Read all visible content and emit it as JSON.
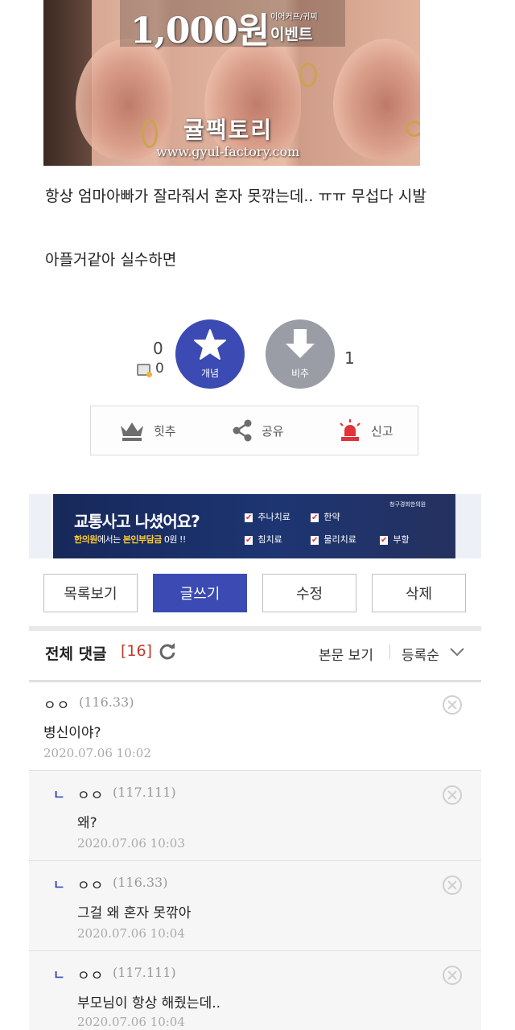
{
  "photo": {
    "price": "1,000원",
    "price_sub": "이어커프/귀찌",
    "price_event": "이벤트",
    "brand": "귤팩토리",
    "url": "www.gyul-factory.com"
  },
  "post": {
    "line1": "항상 엄마아빠가 잘라줘서 혼자 못깎는데.. ㅠㅠ 무섭다 시발",
    "line2": "아플거같아 실수하면"
  },
  "vote": {
    "up_count": "0",
    "up_fix_count": "0",
    "up_label": "개념",
    "down_label": "비추",
    "down_count": "1"
  },
  "actions": {
    "hit": "힛추",
    "share": "공유",
    "report": "신고"
  },
  "banner": {
    "title": "교통사고 나셨어요?",
    "sub_a": "한의원",
    "sub_b": "에서는 ",
    "sub_c": "본인부담금",
    "sub_d": " 0원 !!",
    "checks": [
      "추나치료",
      "한약",
      "침치료",
      "물리치료",
      "부항"
    ],
    "clinic": "청구경희한의원"
  },
  "buttons": {
    "list": "목록보기",
    "write": "글쓰기",
    "edit": "수정",
    "delete": "삭제"
  },
  "comments_header": {
    "title": "전체 댓글",
    "count": "[16]",
    "view_body": "본문 보기",
    "order": "등록순"
  },
  "comments": [
    {
      "name": "ㅇㅇ",
      "ip": "(116.33)",
      "text": "병신이야?",
      "date": "2020.07.06 10:02"
    },
    {
      "name": "ㅇㅇ",
      "ip": "(117.111)",
      "text": "왜?",
      "date": "2020.07.06 10:03"
    },
    {
      "name": "ㅇㅇ",
      "ip": "(116.33)",
      "text": "그걸 왜 혼자 못깎아",
      "date": "2020.07.06 10:04"
    },
    {
      "name": "ㅇㅇ",
      "ip": "(117.111)",
      "text": "부모님이 항상 해줬는데..",
      "date": "2020.07.06 10:04"
    }
  ],
  "reply_mark": "ㄴ",
  "colors": {
    "accent": "#3b4bb3",
    "downvote": "#9a9ca6",
    "comment_count": "#c0392b",
    "banner_bg": "#1d3572"
  }
}
